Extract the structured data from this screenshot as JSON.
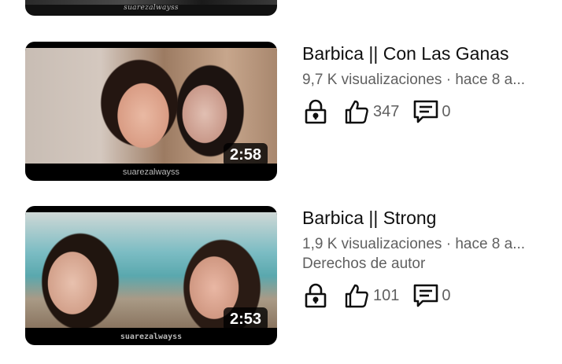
{
  "top_video": {
    "watermark": "suarezalwayss"
  },
  "videos": [
    {
      "title": "Barbica || Con Las Ganas",
      "views": "9,7 K visualizaciones",
      "separator": " · ",
      "age": "hace 8 a...",
      "copyright": "",
      "duration": "2:58",
      "watermark": "suarezalwayss",
      "likes": "347",
      "comments": "0",
      "icons": [
        "lock-icon",
        "thumbs-up-icon",
        "comment-icon"
      ]
    },
    {
      "title": "Barbica || Strong",
      "views": "1,9 K visualizaciones",
      "separator": " · ",
      "age": "hace 8 a...",
      "copyright": "Derechos de autor",
      "duration": "2:53",
      "watermark": "suarezalwayss",
      "likes": "101",
      "comments": "0",
      "icons": [
        "lock-icon",
        "thumbs-up-icon",
        "comment-icon"
      ]
    }
  ],
  "colors": {
    "text_primary": "#0f0f0f",
    "text_secondary": "#606060",
    "duration_bg": "#000000cc"
  }
}
